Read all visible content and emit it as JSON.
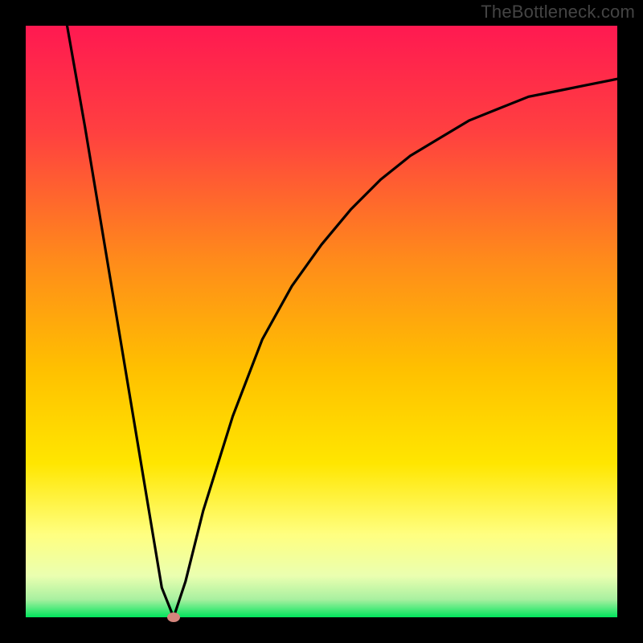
{
  "watermark": "TheBottleneck.com",
  "colors": {
    "frame_bg": "#000000",
    "curve": "#000000",
    "marker": "#d4857c",
    "gradient_top": "#ff1951",
    "gradient_mid1": "#ff8c1a",
    "gradient_mid2": "#ffd400",
    "gradient_mid3": "#ffff66",
    "gradient_bottom": "#00e55c"
  },
  "chart_data": {
    "type": "line",
    "title": "",
    "xlabel": "",
    "ylabel": "",
    "xlim": [
      0,
      100
    ],
    "ylim": [
      0,
      100
    ],
    "grid": false,
    "legend": false,
    "notes": "Single V-shaped curve over a vertical heat gradient. Left branch is steep/linear, right branch asymptotic. Minimum marked with a dot.",
    "series": [
      {
        "name": "curve",
        "x": [
          7,
          10,
          15,
          20,
          23,
          25,
          27,
          30,
          35,
          40,
          45,
          50,
          55,
          60,
          65,
          70,
          75,
          80,
          85,
          90,
          95,
          100
        ],
        "y": [
          100,
          83,
          53,
          23,
          5,
          0,
          6,
          18,
          34,
          47,
          56,
          63,
          69,
          74,
          78,
          81,
          84,
          86,
          88,
          89,
          90,
          91
        ]
      }
    ],
    "marker": {
      "x": 25,
      "y": 0
    }
  }
}
